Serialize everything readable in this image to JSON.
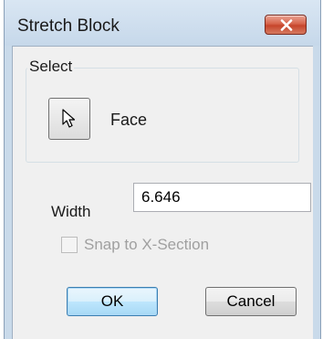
{
  "window": {
    "title": "Stretch Block"
  },
  "select_group": {
    "label": "Select",
    "button_icon": "cursor-arrow-icon",
    "mode_label": "Face"
  },
  "width": {
    "label": "Width",
    "value": "6.646"
  },
  "snap": {
    "label": "Snap to X-Section",
    "checked": false,
    "enabled": false
  },
  "buttons": {
    "ok_label": "OK",
    "cancel_label": "Cancel"
  },
  "colors": {
    "close_button": "#c6452b",
    "title_bar": "#c9daea",
    "dialog_background": "#f0f0f0"
  }
}
